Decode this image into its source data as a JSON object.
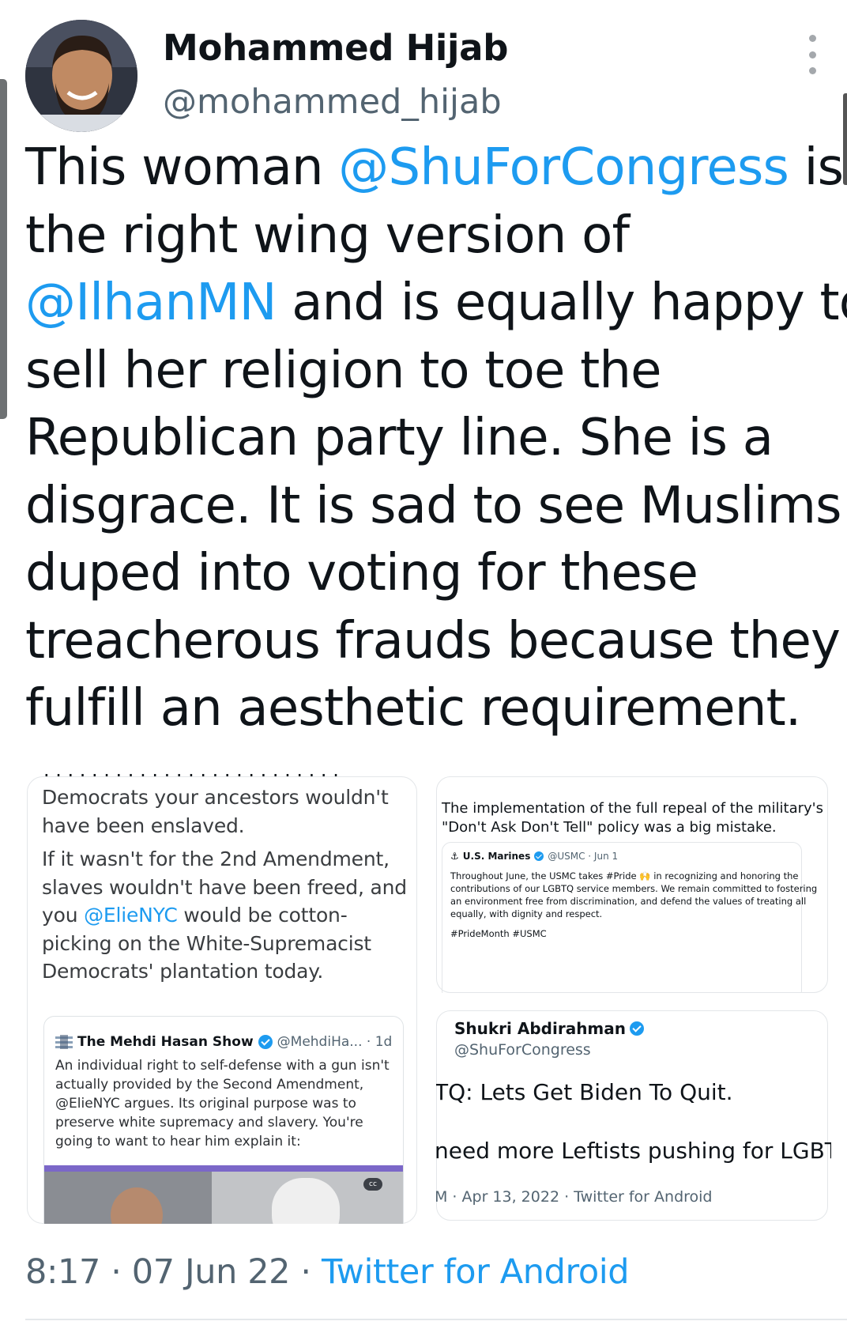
{
  "author": {
    "name": "Mohammed Hijab",
    "handle": "@mohammed_hijab"
  },
  "tweet": {
    "lines": [
      [
        {
          "t": "This woman "
        },
        {
          "t": "@ShuForCongress",
          "m": true
        },
        {
          "t": " is"
        }
      ],
      [
        {
          "t": "the right wing version of"
        }
      ],
      [
        {
          "t": "@IlhanMN",
          "m": true
        },
        {
          "t": " and is equally happy to"
        }
      ],
      [
        {
          "t": "sell her religion to toe the"
        }
      ],
      [
        {
          "t": "Republican party line. She is a"
        }
      ],
      [
        {
          "t": "disgrace. It is sad to see Muslims"
        }
      ],
      [
        {
          "t": "duped into voting for these"
        }
      ],
      [
        {
          "t": "treacherous frauds because they"
        }
      ],
      [
        {
          "t": "fulfill an aesthetic requirement."
        }
      ]
    ]
  },
  "media": {
    "left": {
      "para1": [
        "Democrats your ancestors wouldn't",
        "have been enslaved."
      ],
      "para2": [
        "If it wasn't for the 2nd Amendment,",
        "slaves wouldn't have been freed, and",
        "you @ElieNYC would be cotton-",
        "picking on the White-Supremacist",
        "Democrats' plantation today."
      ],
      "mention": "@ElieNYC",
      "quote": {
        "name": "The Mehdi Hasan Show",
        "handle": "@MehdiHa... · 1d",
        "body": [
          "An individual right to self-defense with a gun isn't",
          "actually provided by the Second Amendment,",
          "@ElieNYC argues. Its original purpose was to",
          "preserve white supremacy and slavery. You're",
          "going to want to hear him explain it:"
        ],
        "cc": "cc"
      }
    },
    "right_top": {
      "text": [
        "The implementation of the full repeal of the military's",
        "\"Don't Ask Don't Tell\" policy was a big mistake."
      ],
      "card": {
        "name": "U.S. Marines",
        "handle": "@USMC · Jun 1",
        "body": [
          "Throughout June, the USMC takes #Pride 🙌 in recognizing and honoring the",
          "contributions of our LGBTQ service members. We remain committed to fostering",
          "an environment free from discrimination, and defend the values of treating all",
          "equally, with dignity and respect."
        ],
        "tags": "#PrideMonth #USMC"
      }
    },
    "right_bottom": {
      "name": "Shukri Abdirahman",
      "handle": "@ShuForCongress",
      "line1": "TQ: Lets Get Biden To Quit.",
      "line2": "need more Leftists pushing for LGBTQ",
      "meta": "M · Apr 13, 2022 · Twitter for Android"
    }
  },
  "footer": {
    "time": "8:17 · 07 Jun 22 · ",
    "source": "Twitter for Android"
  },
  "colors": {
    "link": "#1d9bf0",
    "secondary_text": "#536471"
  }
}
